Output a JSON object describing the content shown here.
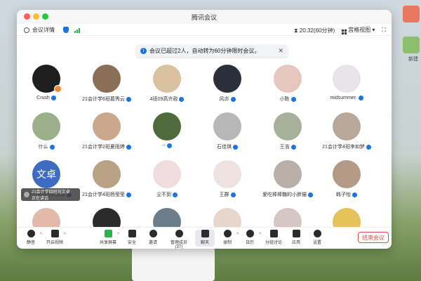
{
  "window": {
    "title": "腾讯会议"
  },
  "infobar": {
    "details_label": "会议详情",
    "timer": "20:32(60分钟)",
    "view_label": "宫格视图"
  },
  "notice": {
    "text": "会议已超过2人，自动转为60分钟限时会议。"
  },
  "participants": [
    {
      "name": "Crush",
      "avatar_color": "#1e1e1e"
    },
    {
      "name": "21会计学6班葛秀云",
      "avatar_color": "#8a6e55"
    },
    {
      "name": "4班09高许政",
      "avatar_color": "#d9c2a0"
    },
    {
      "name": "风亦",
      "avatar_color": "#2a2f3a"
    },
    {
      "name": "小陈",
      "avatar_color": "#e6c7c0"
    },
    {
      "name": "midsummer.",
      "avatar_color": "#e9e4e7"
    },
    {
      "name": "什么",
      "avatar_color": "#9bb08a"
    },
    {
      "name": "21会计学2班夏雨婷",
      "avatar_color": "#c9a88d"
    },
    {
      "name": "-- ",
      "avatar_color": "#4f6b3e"
    },
    {
      "name": "石佳琪",
      "avatar_color": "#b7b7b7"
    },
    {
      "name": "王浩",
      "avatar_color": "#a7b09a"
    },
    {
      "name": "21会计学4班李如梦",
      "avatar_color": "#b9a89a"
    },
    {
      "name": "21会计学四班刘文卓",
      "avatar_color": "#3d6cc2",
      "avatar_text": "文卓"
    },
    {
      "name": "21会计学4班杨莹莹",
      "avatar_color": "#b8a184"
    },
    {
      "name": "尘不到",
      "avatar_color": "#f0dde0"
    },
    {
      "name": "王群",
      "avatar_color": "#efe3e1"
    },
    {
      "name": "爱吃棒棒糖的小胖猫",
      "avatar_color": "#b9afa8"
    },
    {
      "name": "韩子怡",
      "avatar_color": "#b39a86"
    },
    {
      "name": "",
      "avatar_color": "#e3b9a9"
    },
    {
      "name": "",
      "avatar_color": "#2b2b2b"
    },
    {
      "name": "",
      "avatar_color": "#6d7d89"
    },
    {
      "name": "",
      "avatar_color": "#e8d6cc"
    },
    {
      "name": "",
      "avatar_color": "#d7c6c6"
    },
    {
      "name": "",
      "avatar_color": "#e5c25a"
    }
  ],
  "float_tag": {
    "line1": "21会计学四班刘文卓",
    "line2": "正在讲话"
  },
  "toolbar": {
    "mute": "静音",
    "video": "开启视频",
    "share": "共享屏幕",
    "security": "安全",
    "invite": "邀请",
    "members": "管理成员(37)",
    "chat": "聊天",
    "record": "录制",
    "apps": "应用",
    "breakout": "分组讨论",
    "more": "应用",
    "settings": "设置",
    "end": "结束会议",
    "subtitles": "日历"
  },
  "desktop": {
    "folder_label": "新建"
  }
}
